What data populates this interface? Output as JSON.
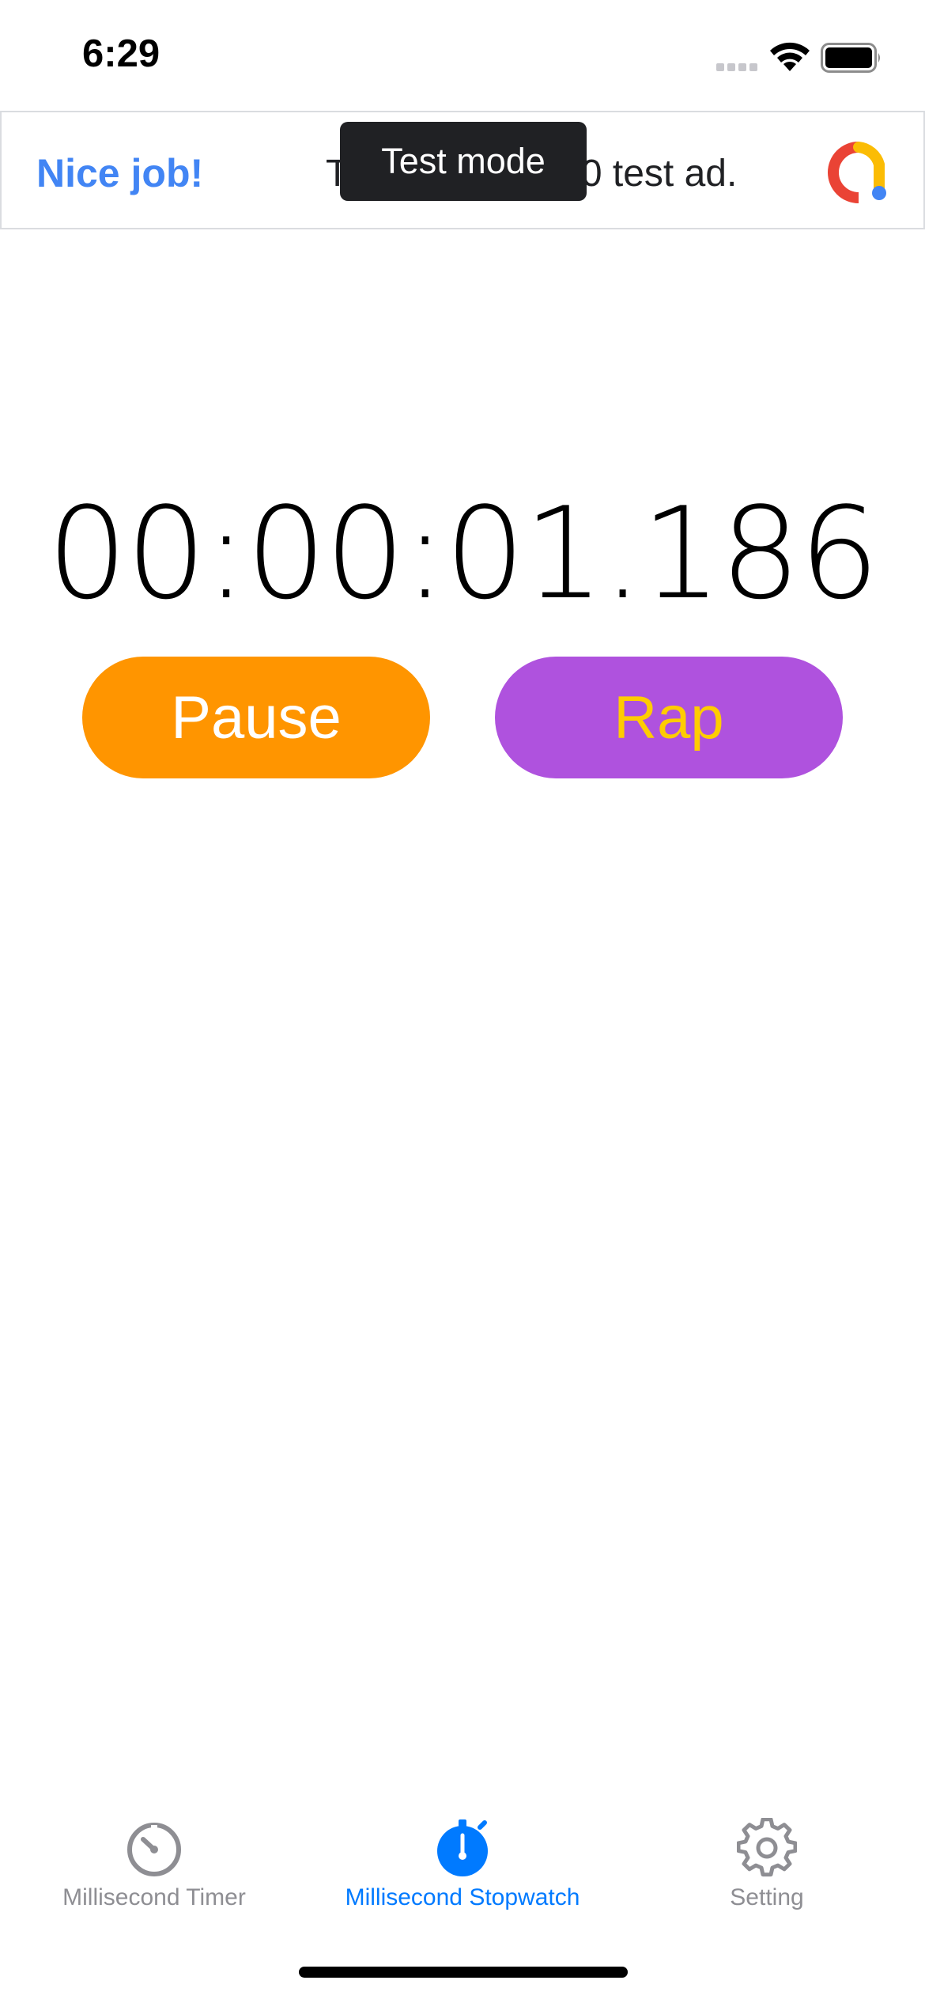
{
  "status_bar": {
    "time": "6:29"
  },
  "ad": {
    "headline": "Nice job!",
    "body": "This is a 320x50 test ad.",
    "test_mode_label": "Test mode"
  },
  "stopwatch": {
    "elapsed": "00:00:01.186"
  },
  "buttons": {
    "pause_label": "Pause",
    "rap_label": "Rap"
  },
  "tab_bar": {
    "tabs": [
      {
        "label": "Millisecond Timer",
        "icon": "timer-icon",
        "active": false
      },
      {
        "label": "Millisecond Stopwatch",
        "icon": "stopwatch-icon",
        "active": true
      },
      {
        "label": "Setting",
        "icon": "gear-icon",
        "active": false
      }
    ]
  },
  "colors": {
    "pause": "#ff9500",
    "rap": "#af52de",
    "rap_text": "#ffcc00",
    "active_tab": "#007aff",
    "inactive_tab": "#8e8e93",
    "ad_headline": "#4285f4"
  }
}
